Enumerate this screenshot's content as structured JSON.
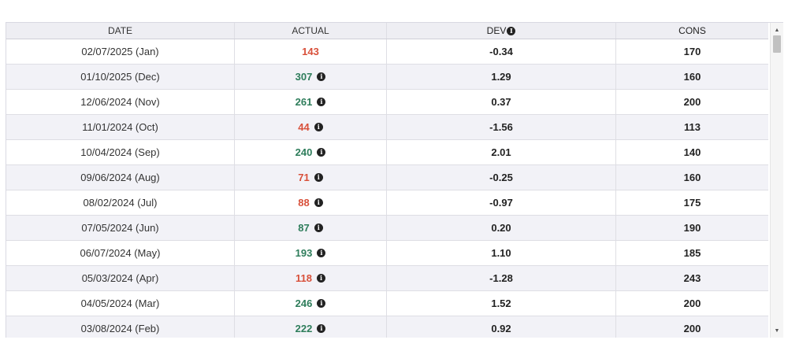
{
  "table": {
    "headers": {
      "date": "DATE",
      "actual": "ACTUAL",
      "dev": "DEV",
      "cons": "CONS"
    },
    "rows": [
      {
        "date": "02/07/2025 (Jan)",
        "actual": "143",
        "dev": "-0.34",
        "cons": "170",
        "trend": "down",
        "info": false
      },
      {
        "date": "01/10/2025 (Dec)",
        "actual": "307",
        "dev": "1.29",
        "cons": "160",
        "trend": "up",
        "info": true
      },
      {
        "date": "12/06/2024 (Nov)",
        "actual": "261",
        "dev": "0.37",
        "cons": "200",
        "trend": "up",
        "info": true
      },
      {
        "date": "11/01/2024 (Oct)",
        "actual": "44",
        "dev": "-1.56",
        "cons": "113",
        "trend": "down",
        "info": true
      },
      {
        "date": "10/04/2024 (Sep)",
        "actual": "240",
        "dev": "2.01",
        "cons": "140",
        "trend": "up",
        "info": true
      },
      {
        "date": "09/06/2024 (Aug)",
        "actual": "71",
        "dev": "-0.25",
        "cons": "160",
        "trend": "down",
        "info": true
      },
      {
        "date": "08/02/2024 (Jul)",
        "actual": "88",
        "dev": "-0.97",
        "cons": "175",
        "trend": "down",
        "info": true
      },
      {
        "date": "07/05/2024 (Jun)",
        "actual": "87",
        "dev": "0.20",
        "cons": "190",
        "trend": "up",
        "info": true
      },
      {
        "date": "06/07/2024 (May)",
        "actual": "193",
        "dev": "1.10",
        "cons": "185",
        "trend": "up",
        "info": true
      },
      {
        "date": "05/03/2024 (Apr)",
        "actual": "118",
        "dev": "-1.28",
        "cons": "243",
        "trend": "down",
        "info": true
      },
      {
        "date": "04/05/2024 (Mar)",
        "actual": "246",
        "dev": "1.52",
        "cons": "200",
        "trend": "up",
        "info": true
      },
      {
        "date": "03/08/2024 (Feb)",
        "actual": "222",
        "dev": "0.92",
        "cons": "200",
        "trend": "up",
        "info": true
      }
    ]
  },
  "icons": {
    "info": "info-circle-icon",
    "scroll_up": "scroll-up-arrow-icon",
    "scroll_down": "scroll-down-arrow-icon"
  },
  "colors": {
    "up": "#2e7d5b",
    "down": "#d8503a",
    "header_bg": "#eeeef3",
    "alt_row_bg": "#f2f2f7"
  }
}
